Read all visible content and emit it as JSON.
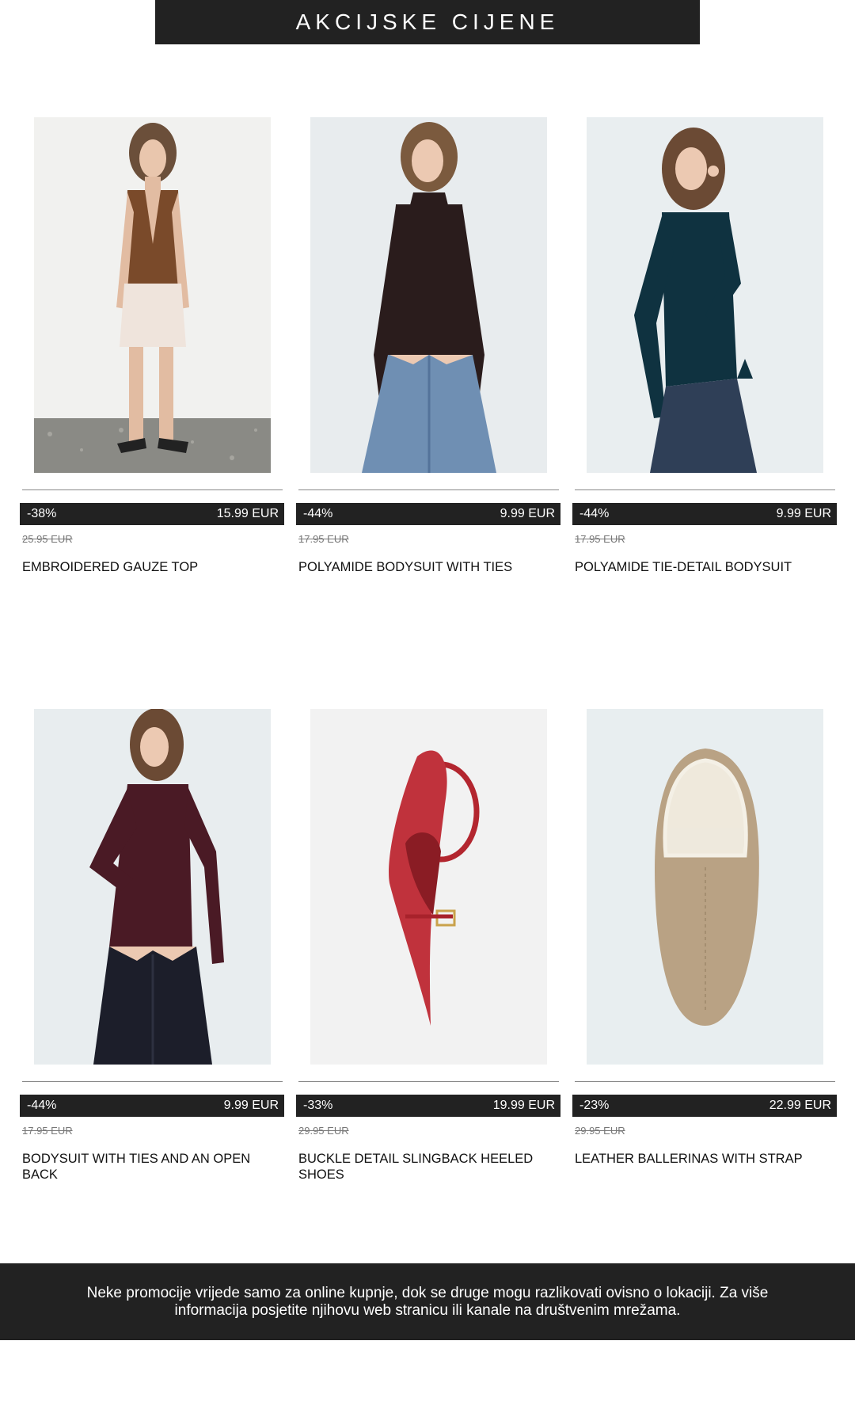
{
  "banner": {
    "title": "AKCIJSKE CIJENE"
  },
  "products": [
    {
      "name": "EMBROIDERED GAUZE TOP",
      "discount": "-38%",
      "price": "15.99 EUR",
      "old_price": "25.95 EUR",
      "image": "model-brown-vest-image"
    },
    {
      "name": "POLYAMIDE BODYSUIT WITH TIES",
      "discount": "-44%",
      "price": "9.99 EUR",
      "old_price": "17.95 EUR",
      "image": "model-black-bodysuit-image"
    },
    {
      "name": "POLYAMIDE TIE-DETAIL BODYSUIT",
      "discount": "-44%",
      "price": "9.99 EUR",
      "old_price": "17.95 EUR",
      "image": "model-navy-bodysuit-image"
    },
    {
      "name": "BODYSUIT WITH TIES AND AN OPEN BACK",
      "discount": "-44%",
      "price": "9.99 EUR",
      "old_price": "17.95 EUR",
      "image": "model-burgundy-bodysuit-image"
    },
    {
      "name": "BUCKLE DETAIL SLINGBACK HEELED SHOES",
      "discount": "-33%",
      "price": "19.99 EUR",
      "old_price": "29.95 EUR",
      "image": "red-slingback-heel-image"
    },
    {
      "name": "LEATHER BALLERINAS WITH STRAP",
      "discount": "-23%",
      "price": "22.99 EUR",
      "old_price": "29.95 EUR",
      "image": "beige-ballerina-image"
    }
  ],
  "footer": {
    "text": "Neke promocije vrijede samo za online kupnje, dok se druge mogu razlikovati ovisno o lokaciji. Za više informacija posjetite njihovu web stranicu ili kanale na društvenim mrežama."
  },
  "colors": {
    "dark": "#222222",
    "muted": "#777777"
  }
}
